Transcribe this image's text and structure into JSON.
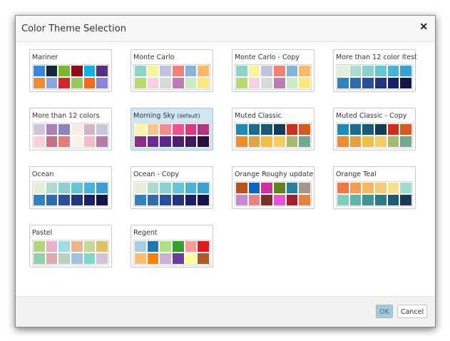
{
  "dialog": {
    "title": "Color Theme Selection",
    "close_icon": "close-icon",
    "ok_label": "OK",
    "cancel_label": "Cancel"
  },
  "themes": [
    {
      "name": "Mariner",
      "default_tag": "",
      "selected": false,
      "colors": [
        "#3a86d8",
        "#17283e",
        "#7fb62f",
        "#8b0e1a",
        "#15aee2",
        "#55307f",
        "#ee8b34",
        "#82a9e5",
        "#cf282d",
        "#9bc75f",
        "#f06b1c",
        "#8c85d5"
      ]
    },
    {
      "name": "Monte Carlo",
      "default_tag": "",
      "selected": false,
      "colors": [
        "#8ed2c8",
        "#f8f298",
        "#c3c2dc",
        "#ef8178",
        "#88b3d7",
        "#fbb866",
        "#b7d96e",
        "#f9cfe4",
        "#d9d9d9",
        "#bb7cb8",
        "#c9ecc4",
        "#fbe77a"
      ]
    },
    {
      "name": "Monte Carlo - Copy",
      "default_tag": "",
      "selected": false,
      "colors": [
        "#8ed2c8",
        "#f8f298",
        "#c3c2dc",
        "#ef8178",
        "#88b3d7",
        "#fbb866",
        "#b7d96e",
        "#f9cfe4",
        "#d9d9d9",
        "#bb7cb8",
        "#c9ecc4",
        "#fbe77a"
      ]
    },
    {
      "name": "More than 12 color Itest",
      "default_tag": "",
      "selected": false,
      "colors": [
        "#dff0d6",
        "#aedbcf",
        "#8dd0cf",
        "#68c3d4",
        "#4cb1d5",
        "#3a9fd1",
        "#3282c2",
        "#2f6bb1",
        "#2b4f9c",
        "#23367b",
        "#1b2168",
        "#15154d"
      ]
    },
    {
      "name": "More than 12 colors",
      "default_tag": "",
      "selected": false,
      "colors": [
        "#cfc2d9",
        "#ab80b8",
        "#8d84bc",
        "#f8ecdf",
        "#d4b5c8",
        "#c9c6e0",
        "#f5d2d6",
        "#c66f89",
        "#e37d79",
        "#fbf2ea",
        "#f5bcc6",
        "#b57ba9"
      ]
    },
    {
      "name": "Morning Sky",
      "default_tag": "(default)",
      "selected": true,
      "colors": [
        "#fcf3ac",
        "#fbc48d",
        "#f18c91",
        "#e9558d",
        "#d63b7d",
        "#b4357d",
        "#8e2c87",
        "#6a2b92",
        "#552a8c",
        "#4b2072",
        "#3e1a5a",
        "#2a1038"
      ]
    },
    {
      "name": "Muted Classic",
      "default_tag": "",
      "selected": false,
      "colors": [
        "#1f8bb4",
        "#1b6d8f",
        "#195a77",
        "#133d5a",
        "#c8321a",
        "#d55a1f",
        "#f38a2e",
        "#e7a13f",
        "#f2bf44",
        "#f7cd5f",
        "#a5ba70",
        "#6fa98e"
      ]
    },
    {
      "name": "Muted Classic - Copy",
      "default_tag": "",
      "selected": false,
      "colors": [
        "#1f8bb4",
        "#1b6d8f",
        "#195a77",
        "#133d5a",
        "#c8321a",
        "#d55a1f",
        "#f38a2e",
        "#e7a13f",
        "#f2bf44",
        "#f7cd5f",
        "#a5ba70",
        "#6fa98e"
      ]
    },
    {
      "name": "Ocean",
      "default_tag": "",
      "selected": false,
      "colors": [
        "#dff0d6",
        "#aedbcf",
        "#8dd0cf",
        "#68c3d4",
        "#4cb1d5",
        "#3a9fd1",
        "#3282c2",
        "#2f6bb1",
        "#2b4f9c",
        "#23367b",
        "#1b2168",
        "#15154d"
      ]
    },
    {
      "name": "Ocean - Copy",
      "default_tag": "",
      "selected": false,
      "colors": [
        "#dff0d6",
        "#aedbcf",
        "#8dd0cf",
        "#68c3d4",
        "#4cb1d5",
        "#3a9fd1",
        "#3282c2",
        "#2f6bb1",
        "#2b4f9c",
        "#23367b",
        "#1b2168",
        "#15154d"
      ]
    },
    {
      "name": "Orange Roughy update",
      "default_tag": "",
      "selected": false,
      "colors": [
        "#b6521d",
        "#0c66c4",
        "#c7339f",
        "#5f8124",
        "#2b7f99",
        "#a2958a",
        "#c788d2",
        "#e98083",
        "#783227",
        "#e654d6",
        "#a51d30",
        "#e6813f"
      ]
    },
    {
      "name": "Orange Teal",
      "default_tag": "",
      "selected": false,
      "colors": [
        "#ef7847",
        "#f39b57",
        "#f6b866",
        "#f5cb78",
        "#f6de92",
        "#9fdccc",
        "#7fcfc1",
        "#5cb6ac",
        "#3d9894",
        "#2a7d85",
        "#1b5b75",
        "#173a5a"
      ]
    },
    {
      "name": "Pastel",
      "default_tag": "",
      "selected": false,
      "colors": [
        "#b4d47d",
        "#eab0c9",
        "#9fdde3",
        "#ebb58d",
        "#c5d79b",
        "#ddc069",
        "#8fd1a9",
        "#e1a8ab",
        "#bbd0bc",
        "#9ec2e0",
        "#7fd7cc",
        "#d4c1dd"
      ]
    },
    {
      "name": "Regent",
      "default_tag": "",
      "selected": false,
      "colors": [
        "#a6cde2",
        "#1f77b3",
        "#b2df8a",
        "#33a02c",
        "#fb9a99",
        "#e31a1c",
        "#fdbf6f",
        "#ff7f00",
        "#cab2d6",
        "#6a3d9a",
        "#ffff99",
        "#b15928"
      ]
    }
  ]
}
